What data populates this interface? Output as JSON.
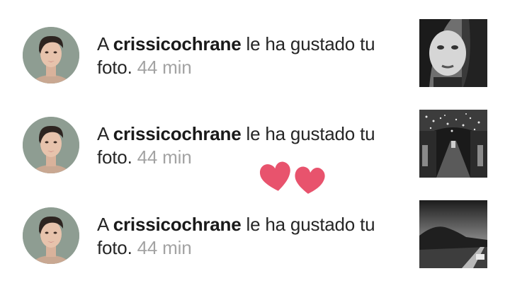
{
  "notifications": [
    {
      "prefix": "A",
      "username": "crissicochrane",
      "action": "le ha gustado tu foto.",
      "time": "44 min",
      "avatar_icon": "user-avatar",
      "thumbnail_icon": "photo-portrait-woman"
    },
    {
      "prefix": "A",
      "username": "crissicochrane",
      "action": "le ha gustado tu foto.",
      "time": "44 min",
      "avatar_icon": "user-avatar",
      "thumbnail_icon": "photo-street-lights"
    },
    {
      "prefix": "A",
      "username": "crissicochrane",
      "action": "le ha gustado tu foto.",
      "time": "44 min",
      "avatar_icon": "user-avatar",
      "thumbnail_icon": "photo-mountain-road"
    }
  ],
  "decoration": {
    "icon": "hearts-icon",
    "color": "#e8536d"
  },
  "colors": {
    "text": "#262626",
    "username": "#1a1a1a",
    "time": "#a3a3a3"
  }
}
